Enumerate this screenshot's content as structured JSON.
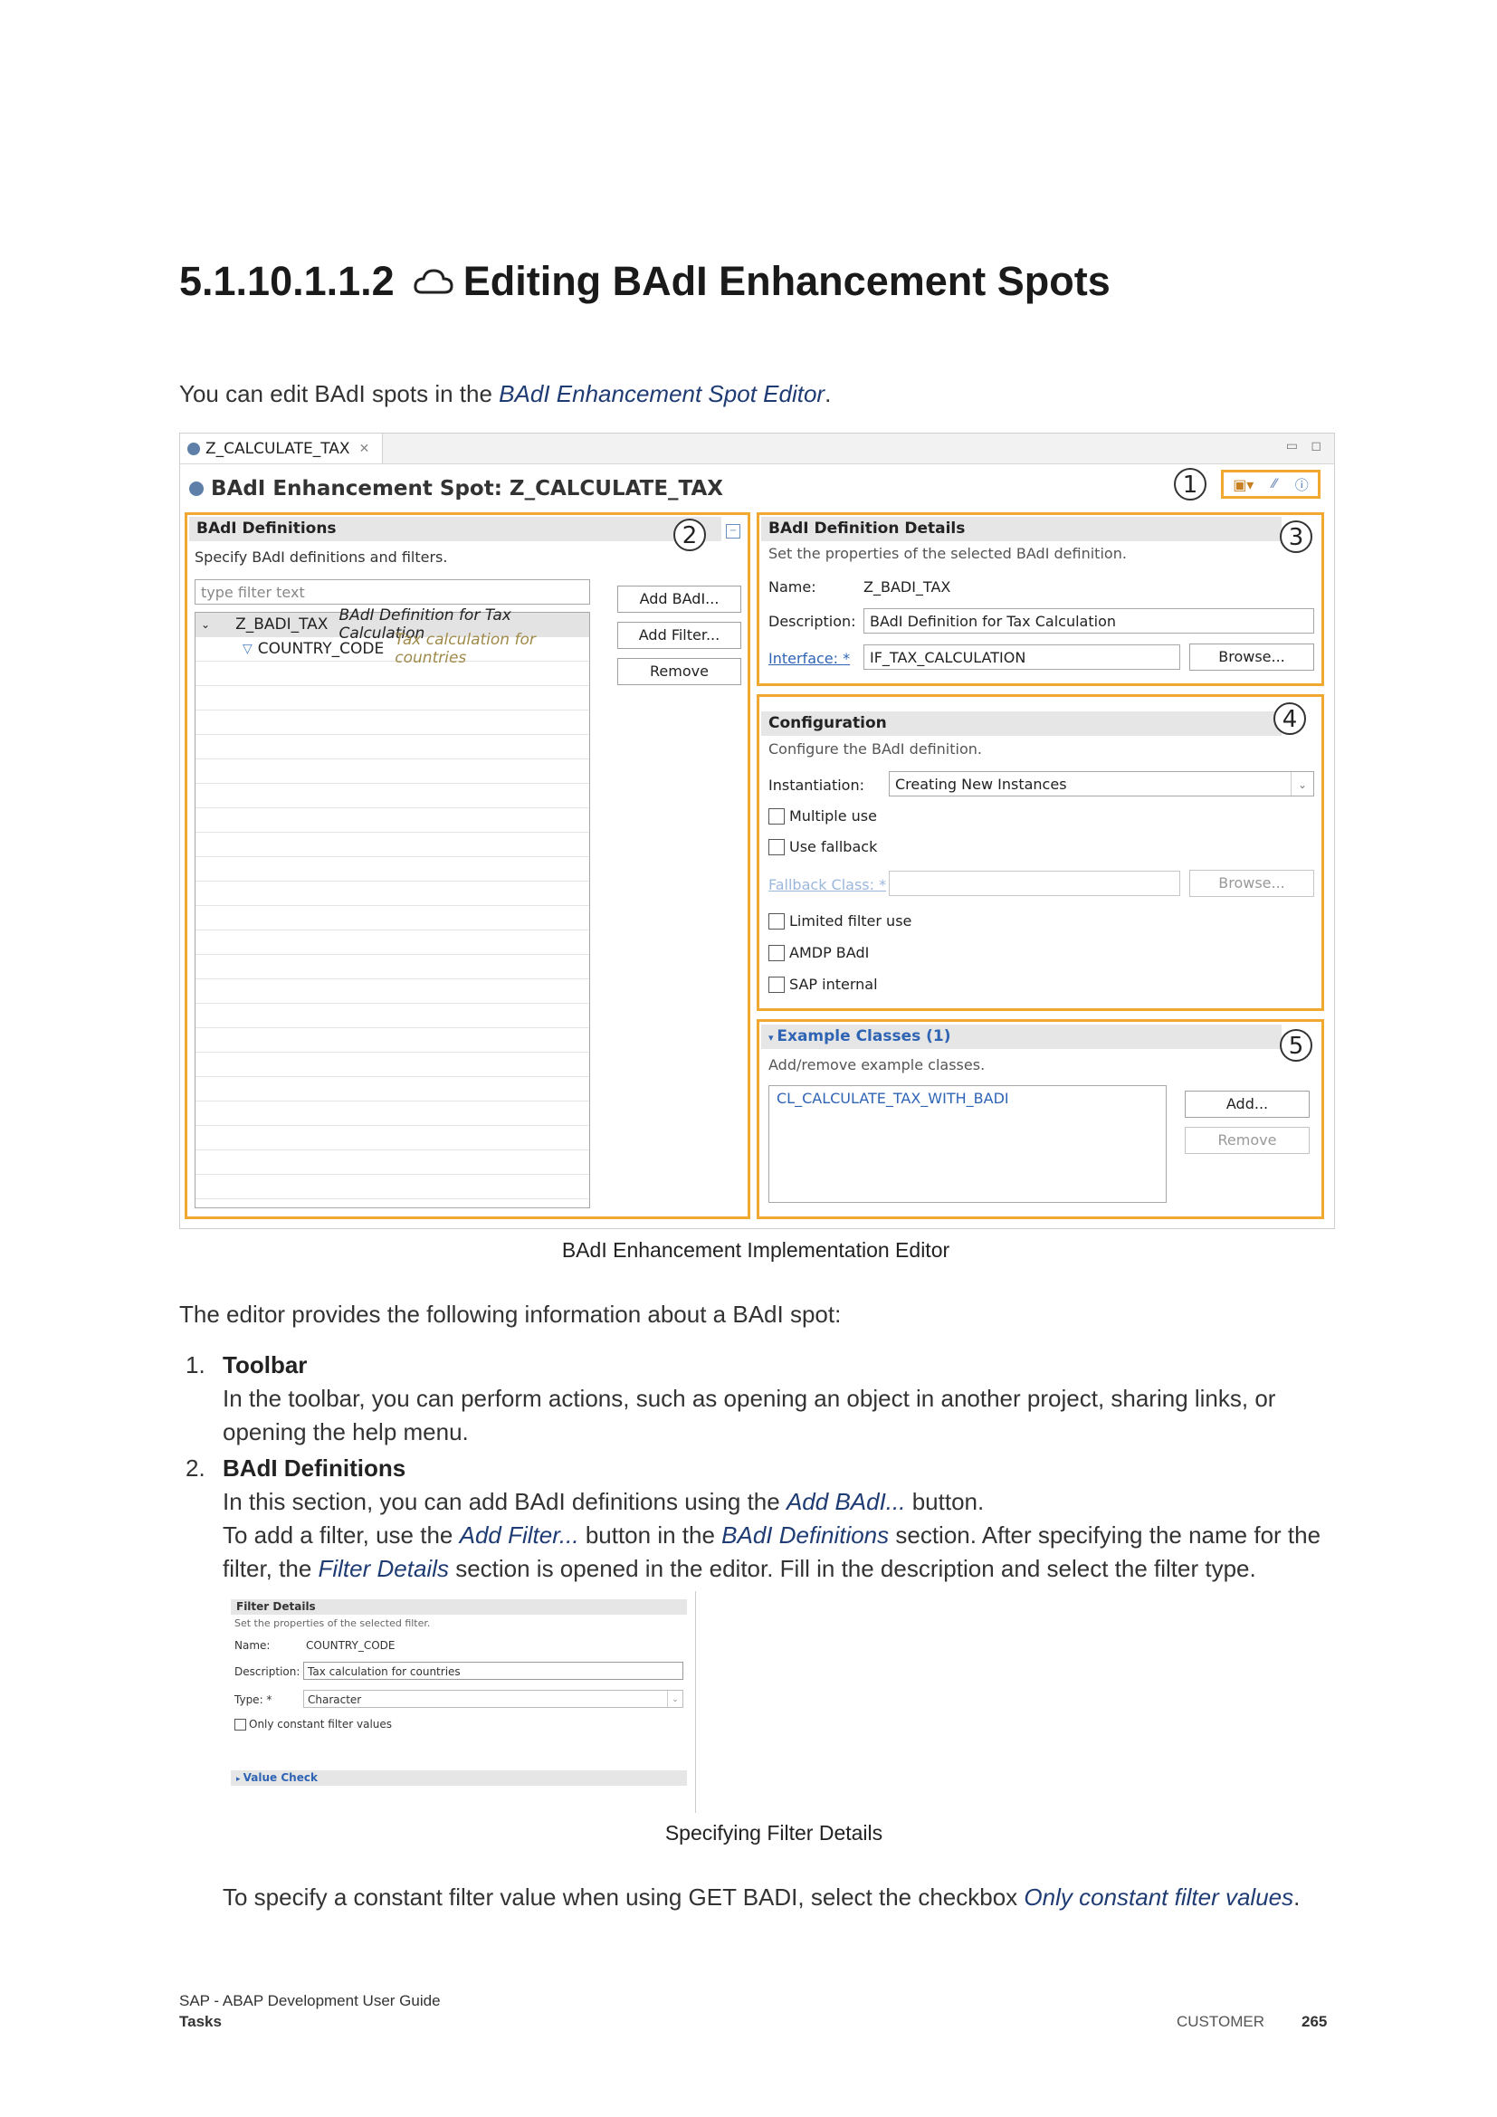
{
  "heading": {
    "number": "5.1.10.1.1.2",
    "title": "Editing BAdI Enhancement Spots"
  },
  "intro": {
    "text": "You can edit BAdI spots in the ",
    "link": "BAdI Enhancement Spot Editor",
    "end": "."
  },
  "editor": {
    "tab_label": "Z_CALCULATE_TAX",
    "title": "BAdI Enhancement Spot: Z_CALCULATE_TAX",
    "callouts": [
      "1",
      "2",
      "3",
      "4",
      "5"
    ],
    "definitions": {
      "header": "BAdI Definitions",
      "subtitle": "Specify BAdI definitions and filters.",
      "filter_placeholder": "type filter text",
      "tree": [
        {
          "name": "Z_BADI_TAX",
          "desc": "BAdI Definition for Tax Calculation"
        },
        {
          "name": "COUNTRY_CODE",
          "desc": "Tax calculation for countries"
        }
      ],
      "buttons": [
        "Add BAdI...",
        "Add Filter...",
        "Remove"
      ]
    },
    "details": {
      "header": "BAdI Definition Details",
      "subtitle": "Set the properties of the selected BAdI definition.",
      "name_label": "Name:",
      "name_value": "Z_BADI_TAX",
      "desc_label": "Description:",
      "desc_value": "BAdI Definition for Tax Calculation",
      "interface_label": "Interface: *",
      "interface_value": "IF_TAX_CALCULATION",
      "browse": "Browse..."
    },
    "configuration": {
      "header": "Configuration",
      "subtitle": "Configure the BAdI definition.",
      "instantiation_label": "Instantiation:",
      "instantiation_value": "Creating New Instances",
      "multiple_use": "Multiple use",
      "use_fallback": "Use fallback",
      "fallback_label": "Fallback Class: *",
      "browse": "Browse...",
      "limited_filter": "Limited filter use",
      "amdp": "AMDP BAdI",
      "sap_internal": "SAP internal"
    },
    "examples": {
      "header": "Example Classes (1)",
      "subtitle": "Add/remove example classes.",
      "items": [
        "CL_CALCULATE_TAX_WITH_BADI"
      ],
      "add": "Add...",
      "remove": "Remove"
    }
  },
  "caption1": "BAdI Enhancement Implementation Editor",
  "body_intro": "The editor provides the following information about a BAdI spot:",
  "list": {
    "item1": {
      "num": "1.",
      "title": "Toolbar",
      "text": "In the toolbar, you can perform actions, such as opening an object in another project, sharing links, or opening the help menu."
    },
    "item2": {
      "num": "2.",
      "title": "BAdI Definitions",
      "l1a": "In this section, you can add BAdI definitions using the ",
      "l1link": "Add BAdI...",
      "l1b": " button.",
      "l2a": "To add a filter, use the ",
      "l2link1": "Add Filter...",
      "l2b": " button in the ",
      "l2link2": "BAdI Definitions",
      "l2c": " section. After specifying the name for the filter, the ",
      "l2link3": "Filter Details",
      "l2d": " section is opened in the editor. Fill in the description and select the filter type."
    }
  },
  "filter_details": {
    "header": "Filter Details",
    "subtitle": "Set the properties of the selected filter.",
    "name_label": "Name:",
    "name_value": "COUNTRY_CODE",
    "desc_label": "Description:",
    "desc_value": "Tax calculation for countries",
    "type_label": "Type: *",
    "type_value": "Character",
    "checkbox": "Only constant filter values",
    "value_check": "Value Check"
  },
  "caption2": "Specifying Filter Details",
  "final": {
    "a": "To specify a constant filter value when using GET BADI, select the checkbox ",
    "link": "Only constant filter values",
    "b": "."
  },
  "footer": {
    "guide": "SAP - ABAP Development User Guide",
    "section": "Tasks",
    "label": "CUSTOMER",
    "page": "265"
  }
}
